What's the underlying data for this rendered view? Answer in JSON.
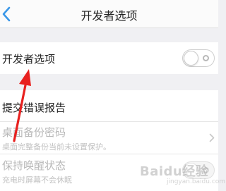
{
  "header": {
    "title": "开发者选项",
    "back_icon": "chevron-left-icon"
  },
  "developer_options": {
    "label": "开发者选项",
    "toggle_on": false
  },
  "bug_report": {
    "label": "提交错误报告"
  },
  "desktop_backup_password": {
    "label": "桌面备份密码",
    "subtitle": "桌面完整备份当前未设置保护。",
    "disabled": true
  },
  "stay_awake": {
    "label": "保持唤醒状态",
    "subtitle": "充电时屏幕不会休眠",
    "disabled": true,
    "toggle_on": false
  },
  "annotation": {
    "arrow_color": "#e8211f",
    "icon": "red-arrow-annotation"
  },
  "watermark": {
    "text": "Baidu经验",
    "subtext": "jingyan.baidu.com"
  },
  "colors": {
    "accent": "#3a97e8",
    "background": "#f0f0f3"
  }
}
